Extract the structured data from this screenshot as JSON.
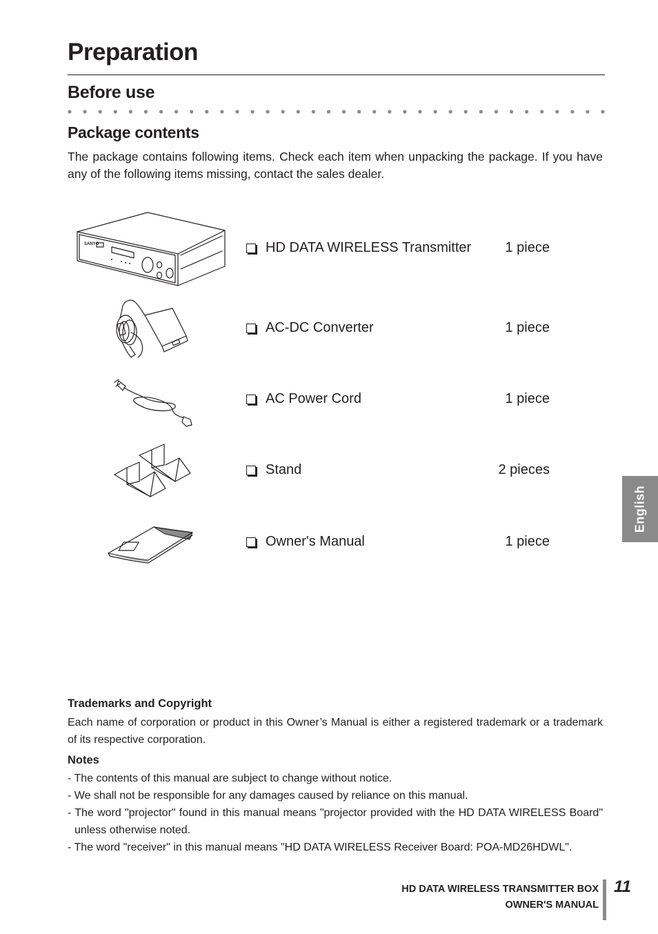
{
  "page": {
    "title": "Preparation",
    "subtitle": "Before use",
    "section_heading": "Package contents",
    "intro": "The package contains following items. Check each item when unpacking the package. If you have any of the following items missing, contact the sales dealer."
  },
  "items": [
    {
      "name": "HD DATA WIRELESS Transmitter",
      "quantity": "1 piece",
      "icon": "transmitter-box-icon"
    },
    {
      "name": "AC-DC Converter",
      "quantity": "1 piece",
      "icon": "ac-adapter-icon"
    },
    {
      "name": "AC Power Cord",
      "quantity": "1 piece",
      "icon": "power-cord-icon"
    },
    {
      "name": "Stand",
      "quantity": "2 pieces",
      "icon": "stand-icon"
    },
    {
      "name": "Owner's Manual",
      "quantity": "1 piece",
      "icon": "manual-booklet-icon"
    }
  ],
  "side_tab": {
    "label": "English"
  },
  "trademarks": {
    "heading": "Trademarks and Copyright",
    "body": "Each name of corporation or product in this Owner’s Manual is either a registered trademark or a trademark of its respective corporation."
  },
  "notes": {
    "heading": "Notes",
    "items": [
      "- The contents of this manual are subject to change without notice.",
      "- We shall not be responsible for any damages caused by reliance on this manual.",
      "- The word \"projector\" found in this manual means \"projector provided with the HD DATA WIRELESS Board\" unless otherwise noted.",
      "- The word \"receiver\" in this manual means \"HD DATA WIRELESS Receiver Board: POA-MD26HDWL\"."
    ]
  },
  "footer": {
    "line1": "HD DATA WIRELESS TRANSMITTER BOX",
    "line2": "OWNER'S MANUAL",
    "page_number": "11"
  },
  "colors": {
    "text": "#231f20",
    "tab_gray": "#8a8a8a",
    "dot_gray": "#8a8a8a"
  }
}
